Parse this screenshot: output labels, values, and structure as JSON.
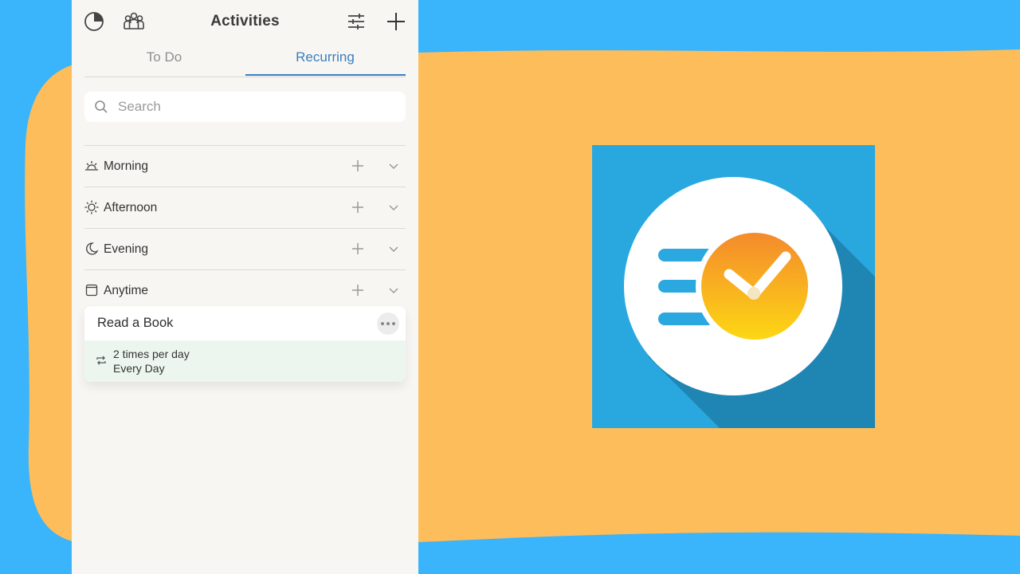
{
  "app": {
    "title": "Activities",
    "header_icons": [
      "pie-chart-icon",
      "group-icon",
      "filter-sliders-icon",
      "plus-icon"
    ]
  },
  "tabs": [
    {
      "label": "To Do",
      "active": false
    },
    {
      "label": "Recurring",
      "active": true
    }
  ],
  "search": {
    "placeholder": "Search",
    "value": ""
  },
  "sections": [
    {
      "label": "Morning",
      "icon": "sunrise-icon"
    },
    {
      "label": "Afternoon",
      "icon": "sun-icon"
    },
    {
      "label": "Evening",
      "icon": "moon-icon"
    },
    {
      "label": "Anytime",
      "icon": "calendar-icon"
    }
  ],
  "activity": {
    "name": "Read a Book",
    "frequency": "2 times per day",
    "schedule": "Every Day"
  },
  "colors": {
    "background_blue": "#3ab4fb",
    "blob_orange": "#fdbd5a",
    "panel": "#f8f6f2",
    "accent": "#3a7fbf",
    "card_detail": "#edf6ee",
    "logo_blue": "#29a8e0",
    "logo_orange": "#f7a326"
  }
}
